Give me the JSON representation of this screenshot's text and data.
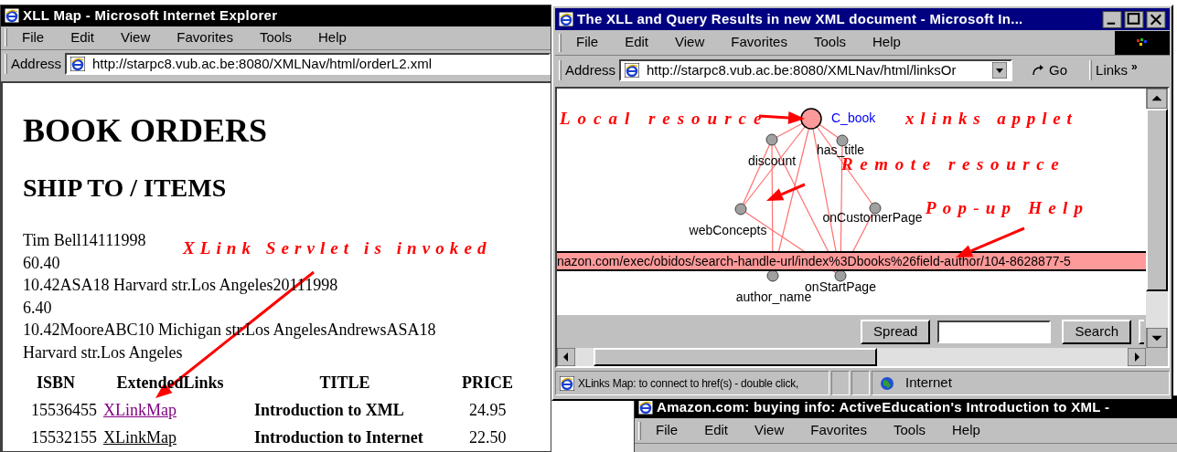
{
  "orders_window": {
    "title": "XLL Map - Microsoft Internet Explorer",
    "active": false,
    "menu": [
      "File",
      "Edit",
      "View",
      "Favorites",
      "Tools",
      "Help"
    ],
    "address_label": "Address",
    "address": "http://starpc8.vub.ac.be:8080/XMLNav/html/orderL2.xml",
    "heading": "BOOK ORDERS",
    "subheading": "SHIP TO / ITEMS",
    "lines": [
      "Tim Bell14111998",
      "60.40",
      "10.42ASA18 Harvard str.Los Angeles20111998",
      "6.40",
      "10.42MooreABC10 Michigan str.Los AngelesAndrewsASA18",
      "Harvard str.Los Angeles"
    ],
    "table": {
      "columns": [
        "ISBN",
        "ExtendedLinks",
        "TITLE",
        "PRICE"
      ],
      "rows": [
        {
          "isbn": "15536455",
          "link": "XLinkMap",
          "visited": true,
          "title": "Introduction to XML",
          "price": "24.95"
        },
        {
          "isbn": "15532155",
          "link": "XLinkMap",
          "visited": false,
          "title": "Introduction to Internet",
          "price": "22.50"
        }
      ]
    }
  },
  "applet_window": {
    "title": "The XLL and Query Results in new XML document - Microsoft In...",
    "active": true,
    "menu": [
      "File",
      "Edit",
      "View",
      "Favorites",
      "Tools",
      "Help"
    ],
    "address_label": "Address",
    "address": "http://starpc8.vub.ac.be:8080/XMLNav/html/linksOr",
    "go": "Go",
    "links": "Links",
    "links_more": "»",
    "graph": {
      "root": "C_book",
      "nodes": [
        "discount",
        "has_title",
        "webConcepts",
        "onCustomerPage",
        "author_name",
        "onStartPage"
      ]
    },
    "tooltip": "nazon.com/exec/obidos/search-handle-url/index%3Dbooks%26field-author/104-8628877-5",
    "buttons": [
      "Spread",
      "Search"
    ],
    "status": "XLinks Map: to connect to href(s) - double click,",
    "zone": "Internet"
  },
  "amazon_window": {
    "title": "Amazon.com: buying info: ActiveEducation's Introduction to XML -",
    "active": false,
    "menu": [
      "File",
      "Edit",
      "View",
      "Favorites",
      "Tools",
      "Help"
    ]
  },
  "annotations": [
    "Local resource",
    "xlinks applet",
    "Remote resource",
    "Pop-up Help",
    "XLink Servlet is invoked"
  ]
}
